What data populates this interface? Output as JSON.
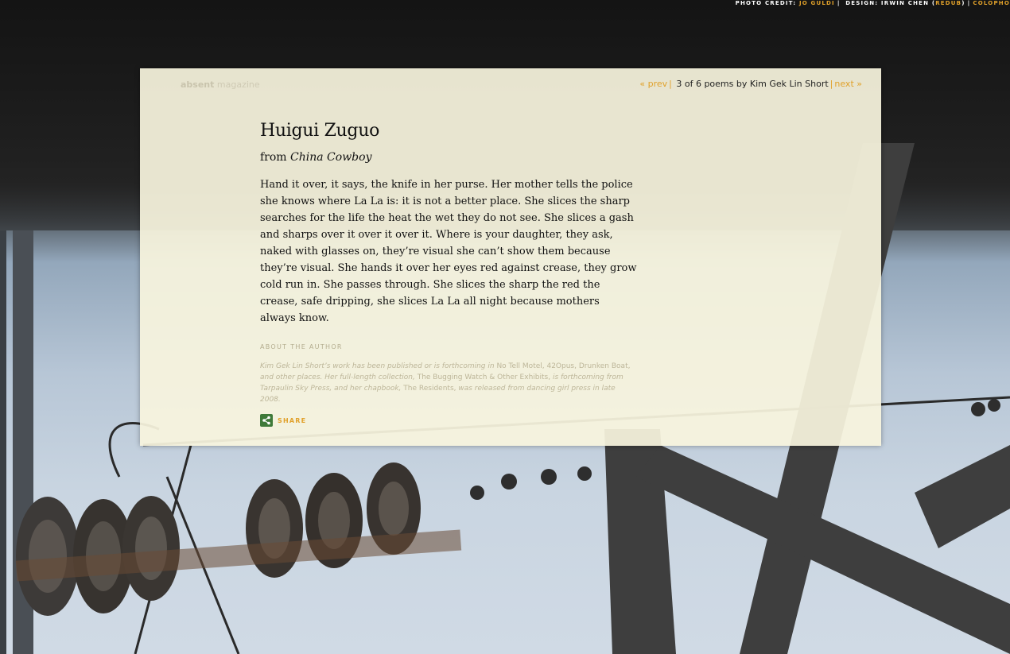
{
  "credits": {
    "prefix": "Photo credit: ",
    "photographer": "Jo Guldi",
    "sep1": "|",
    "design_prefix": " Design: Irwin Chen (",
    "design_link": "Redub",
    "design_suffix": ")",
    "sep2": "|",
    "colophon": "Colopho"
  },
  "brand": {
    "bold": "absent",
    "light": " magazine"
  },
  "nav": {
    "prev": "« prev",
    "sep1": "|",
    "status": " 3 of 6 poems by Kim Gek Lin Short",
    "sep2": "|",
    "next": "next »"
  },
  "poem": {
    "title": "Huigui Zuguo",
    "from_label": "from ",
    "collection": "China Cowboy",
    "body": "Hand it over, it says, the knife in her purse. Her mother tells the police she knows where La La is: it is not a better place. She slices the sharp searches for the life the heat the wet they do not see. She slices a gash and sharps over it over it over it. Where is your daughter, they ask, naked with glasses on, they’re visual she can’t show them because they’re visual. She hands it over her eyes red against crease, they grow cold run in. She passes through. She slices the sharp the red the crease, safe dripping, she slices La La all night because mothers always know."
  },
  "about": {
    "heading": "About the Author",
    "bio_1": "Kim Gek Lin Short’s work has been published or is forthcoming in ",
    "bio_venues": "No Tell Motel, 42Opus, Drunken Boat,",
    "bio_2": " and other places. Her full-length collection, ",
    "bio_book": "The Bugging Watch & Other Exhibits,",
    "bio_3": " is forthcoming from Tarpaulin Sky Press, and her chapbook, ",
    "bio_chapbook": "The Residents,",
    "bio_4": " was released from dancing girl press in late 2008."
  },
  "share": {
    "label": "SHARE",
    "icon": "share-icon"
  },
  "colors": {
    "accent": "#e1a12a",
    "panel": "#f7f4de",
    "share_green": "#3f7a3a"
  }
}
